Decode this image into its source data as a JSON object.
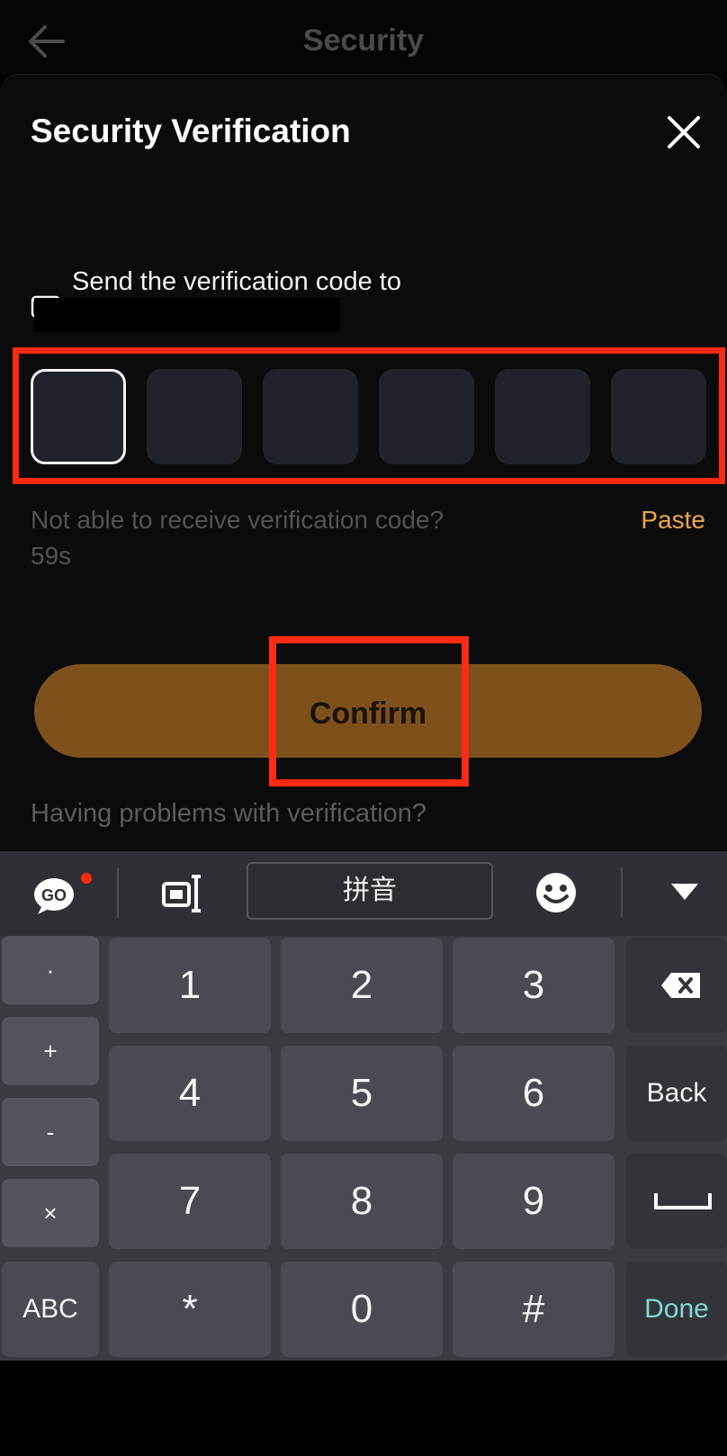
{
  "header": {
    "title": "Security"
  },
  "dialog": {
    "title": "Security Verification",
    "send_label": "Send the verification code to",
    "code_length": 6,
    "not_receive_text": "Not able to receive verification code?",
    "timer": "59s",
    "paste_label": "Paste",
    "confirm_label": "Confirm",
    "problems_text": "Having problems with verification?"
  },
  "keyboard": {
    "toolbar": {
      "go_label": "GO",
      "pinyin_label": "拼音"
    },
    "symbol_keys": [
      "·",
      "+",
      "-",
      "×"
    ],
    "abc_label": "ABC",
    "rows": [
      [
        "1",
        "2",
        "3"
      ],
      [
        "4",
        "5",
        "6"
      ],
      [
        "7",
        "8",
        "9"
      ],
      [
        "*",
        "0",
        "#"
      ]
    ],
    "back_label": "Back",
    "done_label": "Done"
  },
  "colors": {
    "accent": "#f2a744",
    "confirm_bg": "#7e511c",
    "highlight": "#ff2a12",
    "done_text": "#7fd9d6"
  }
}
